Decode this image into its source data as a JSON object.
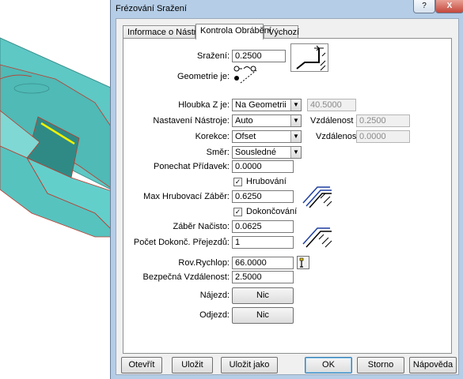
{
  "dialog": {
    "title": "Frézování Sražení",
    "help_glyph": "?",
    "close_glyph": "X"
  },
  "tabs": [
    {
      "label": "Informace o Nástroji"
    },
    {
      "label": "Kontrola Obrábění"
    },
    {
      "label": "Výchozí"
    }
  ],
  "form": {
    "srazeni": {
      "label": "Sražení:",
      "value": "0.2500"
    },
    "geometrie": {
      "label": "Geometrie je:"
    },
    "hloubka": {
      "label": "Hloubka Z je:",
      "value": "Na Geometrii",
      "extra_value": "40.5000"
    },
    "nastaveni": {
      "label": "Nastavení Nástroje:",
      "value": "Auto",
      "extra_label": "Vzdálenost Z:",
      "extra_value": "0.2500"
    },
    "korekce": {
      "label": "Korekce:",
      "value": "Ofset",
      "extra_label": "Vzdálenost:",
      "extra_value": "0.0000"
    },
    "smer": {
      "label": "Směr:",
      "value": "Sousledné"
    },
    "pridavek": {
      "label": "Ponechat Přídavek:",
      "value": "0.0000"
    },
    "hrubovani": {
      "label": "Hrubování",
      "checked": true
    },
    "max_zaber": {
      "label": "Max Hrubovací Záběr:",
      "value": "0.6250"
    },
    "dokoncovani": {
      "label": "Dokončování",
      "checked": true
    },
    "zaber_nacisto": {
      "label": "Záběr Načisto:",
      "value": "0.0625"
    },
    "pocet_prejezdu": {
      "label": "Počet Dokonč. Přejezdů:",
      "value": "1"
    },
    "rov_rychlop": {
      "label": "Rov.Rychlop:",
      "value": "66.0000"
    },
    "bezpecna": {
      "label": "Bezpečná Vzdálenost:",
      "value": "2.5000"
    },
    "najezd": {
      "label": "Nájezd:",
      "button": "Nic"
    },
    "odjezd": {
      "label": "Odjezd:",
      "button": "Nic"
    }
  },
  "footer": {
    "otevrit": "Otevřít",
    "ulozit": "Uložit",
    "ulozit_jako": "Uložit jako",
    "ok": "OK",
    "storno": "Storno",
    "napoveda": "Nápověda"
  },
  "colors": {
    "model_face": "#5ec8c4",
    "model_edge": "#c0392b",
    "highlight_edge": "#f2f200",
    "dialog_frame": "#b5cde6"
  },
  "icons": [
    "chamfer-diagram-icon",
    "geometry-selector-icon",
    "roughing-passes-icon",
    "finishing-passes-icon",
    "pick-point-icon"
  ]
}
